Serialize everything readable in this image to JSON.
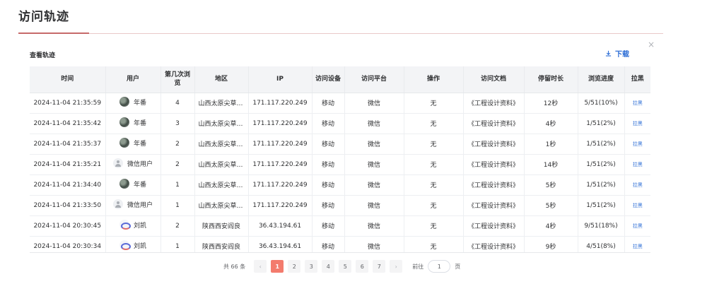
{
  "page": {
    "title": "访问轨迹"
  },
  "dialog": {
    "title": "查看轨迹",
    "download_label": "下载",
    "close_symbol": "×"
  },
  "table": {
    "columns": [
      "时间",
      "用户",
      "第几次浏览",
      "地区",
      "IP",
      "访问设备",
      "访问平台",
      "操作",
      "访问文档",
      "停留时长",
      "浏览进度",
      "拉黑"
    ],
    "rows": [
      {
        "time": "2024-11-04 21:35:59",
        "avatar": "photo",
        "user": "年番",
        "nth": "4",
        "region": "山西太原尖草坪区",
        "ip": "171.117.220.249",
        "device": "移动",
        "platform": "微信",
        "action": "无",
        "doc": "《工程设计资料》",
        "duration": "12秒",
        "progress": "5/51(10%)",
        "blacklist": "拉黑"
      },
      {
        "time": "2024-11-04 21:35:42",
        "avatar": "photo",
        "user": "年番",
        "nth": "3",
        "region": "山西太原尖草坪区",
        "ip": "171.117.220.249",
        "device": "移动",
        "platform": "微信",
        "action": "无",
        "doc": "《工程设计资料》",
        "duration": "4秒",
        "progress": "1/51(2%)",
        "blacklist": "拉黑"
      },
      {
        "time": "2024-11-04 21:35:37",
        "avatar": "photo",
        "user": "年番",
        "nth": "2",
        "region": "山西太原尖草坪区",
        "ip": "171.117.220.249",
        "device": "移动",
        "platform": "微信",
        "action": "无",
        "doc": "《工程设计资料》",
        "duration": "1秒",
        "progress": "1/51(2%)",
        "blacklist": "拉黑"
      },
      {
        "time": "2024-11-04 21:35:21",
        "avatar": "default",
        "user": "微信用户",
        "nth": "2",
        "region": "山西太原尖草坪区",
        "ip": "171.117.220.249",
        "device": "移动",
        "platform": "微信",
        "action": "无",
        "doc": "《工程设计资料》",
        "duration": "14秒",
        "progress": "1/51(2%)",
        "blacklist": "拉黑"
      },
      {
        "time": "2024-11-04 21:34:40",
        "avatar": "photo",
        "user": "年番",
        "nth": "1",
        "region": "山西太原尖草坪区",
        "ip": "171.117.220.249",
        "device": "移动",
        "platform": "微信",
        "action": "无",
        "doc": "《工程设计资料》",
        "duration": "5秒",
        "progress": "1/51(2%)",
        "blacklist": "拉黑"
      },
      {
        "time": "2024-11-04 21:33:50",
        "avatar": "default",
        "user": "微信用户",
        "nth": "1",
        "region": "山西太原尖草坪区",
        "ip": "171.117.220.249",
        "device": "移动",
        "platform": "微信",
        "action": "无",
        "doc": "《工程设计资料》",
        "duration": "5秒",
        "progress": "1/51(2%)",
        "blacklist": "拉黑"
      },
      {
        "time": "2024-11-04 20:30:45",
        "avatar": "cartoon",
        "user": "刘凯",
        "nth": "2",
        "region": "陕西西安阎良",
        "ip": "36.43.194.61",
        "device": "移动",
        "platform": "微信",
        "action": "无",
        "doc": "《工程设计资料》",
        "duration": "4秒",
        "progress": "9/51(18%)",
        "blacklist": "拉黑"
      },
      {
        "time": "2024-11-04 20:30:34",
        "avatar": "cartoon",
        "user": "刘凯",
        "nth": "1",
        "region": "陕西西安阎良",
        "ip": "36.43.194.61",
        "device": "移动",
        "platform": "微信",
        "action": "无",
        "doc": "《工程设计资料》",
        "duration": "9秒",
        "progress": "4/51(8%)",
        "blacklist": "拉黑"
      }
    ]
  },
  "pagination": {
    "total_label": "共 66 条",
    "prev": "‹",
    "next": "›",
    "pages": [
      "1",
      "2",
      "3",
      "4",
      "5",
      "6",
      "7"
    ],
    "current": "1",
    "goto_label": "前往",
    "goto_value": "1",
    "page_unit": "页"
  },
  "colors": {
    "accent": "#f37b6d",
    "link": "#2f6fd6",
    "header_bg": "#f3f4f6"
  }
}
